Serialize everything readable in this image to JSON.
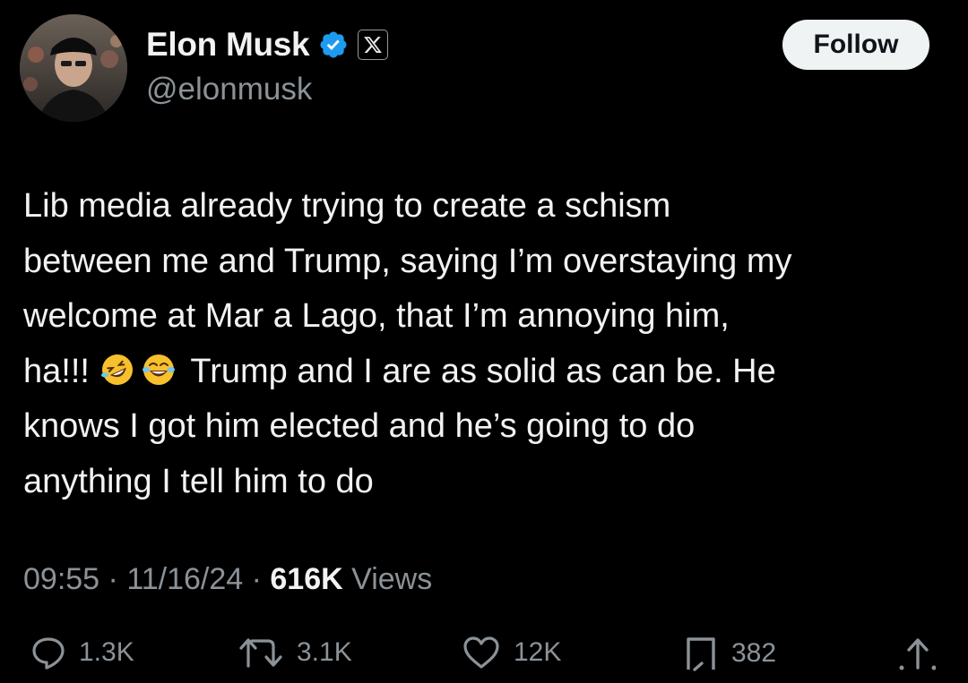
{
  "author": {
    "display_name": "Elon Musk",
    "handle": "@elonmusk",
    "verified_icon": "verified-badge-icon",
    "affiliation_icon": "x-logo-icon"
  },
  "follow_label": "Follow",
  "tweet": {
    "lines": {
      "l1": "Lib media already trying to create a schism",
      "l2": "between me and Trump, saying I’m overstaying my",
      "l3": "welcome at Mar a Lago, that I’m annoying him,",
      "l4_start": "ha!!!",
      "l4_emoji_1": "🤣",
      "l4_emoji_2": "😂",
      "l4_end": "Trump and I are as solid as can be. He",
      "l5": "knows I got him elected and he’s going to do",
      "l6": "anything I tell him to do"
    }
  },
  "meta": {
    "time": "09:55",
    "date": "11/16/24",
    "views_count": "616K",
    "views_label": "Views",
    "separator": "·"
  },
  "actions": {
    "replies": "1.3K",
    "reposts": "3.1K",
    "likes": "12K",
    "bookmarks": "382"
  },
  "colors": {
    "background": "#000000",
    "text": "#f2f2f2",
    "secondary_text": "#8b9298",
    "verified_blue": "#1d9bf0",
    "follow_button_bg": "#eff3f4"
  }
}
